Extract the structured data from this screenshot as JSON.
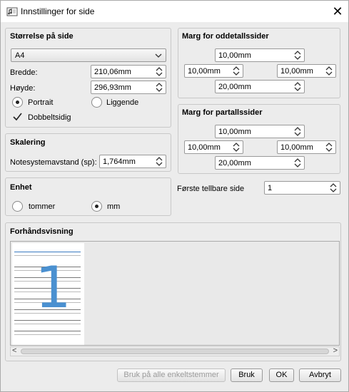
{
  "window": {
    "title": "Innstillinger for side"
  },
  "size_group": {
    "title": "Størrelse på side",
    "paper_size": "A4",
    "width_label": "Bredde:",
    "width_value": "210,06mm",
    "height_label": "Høyde:",
    "height_value": "296,93mm",
    "portrait_label": "Portrait",
    "landscape_label": "Liggende",
    "orientation_selected": "Portrait",
    "twosided_label": "Dobbeltsidig",
    "twosided_checked": true
  },
  "scaling_group": {
    "title": "Skalering",
    "staff_distance_label": "Notesystemavstand (sp):",
    "staff_distance_value": "1,764mm"
  },
  "unit_group": {
    "title": "Enhet",
    "inch_label": "tommer",
    "mm_label": "mm",
    "selected": "mm"
  },
  "odd_margins": {
    "title": "Marg for oddetallssider",
    "top": "10,00mm",
    "left": "10,00mm",
    "right": "10,00mm",
    "bottom": "20,00mm"
  },
  "even_margins": {
    "title": "Marg for partallssider",
    "top": "10,00mm",
    "left": "10,00mm",
    "right": "10,00mm",
    "bottom": "20,00mm"
  },
  "first_page": {
    "label": "Første tellbare side",
    "value": "1"
  },
  "preview": {
    "title": "Forhåndsvisning",
    "page_number": "1",
    "accent_color": "#4a90d0"
  },
  "buttons": {
    "apply_all": "Bruk på alle enkeltstemmer",
    "apply": "Bruk",
    "ok": "OK",
    "cancel": "Avbryt"
  }
}
